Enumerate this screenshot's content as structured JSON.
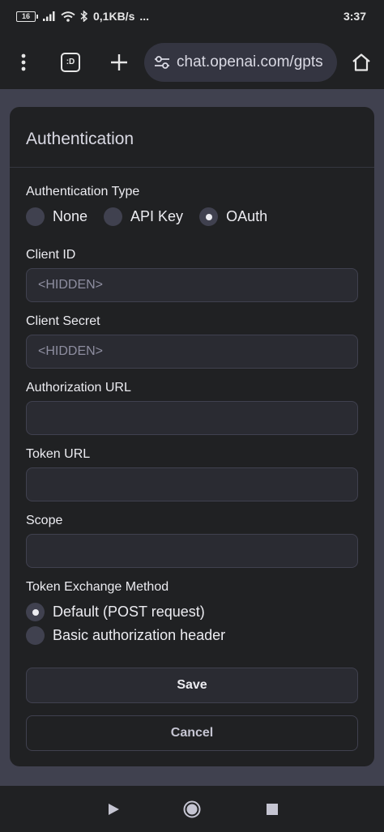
{
  "status_bar": {
    "battery": "16",
    "net_speed": "0,1KB/s",
    "more": "...",
    "time": "3:37"
  },
  "browser": {
    "tab_count": ":D",
    "url": "chat.openai.com/gpts",
    "icons": [
      "more-vert-icon",
      "tab-switcher-icon",
      "new-tab-icon",
      "site-settings-icon",
      "home-icon"
    ]
  },
  "dialog": {
    "title": "Authentication",
    "auth_type": {
      "label": "Authentication Type",
      "options": [
        {
          "label": "None",
          "checked": false
        },
        {
          "label": "API Key",
          "checked": false
        },
        {
          "label": "OAuth",
          "checked": true
        }
      ]
    },
    "client_id": {
      "label": "Client ID",
      "value": "",
      "placeholder": "<HIDDEN>"
    },
    "client_secret": {
      "label": "Client Secret",
      "value": "",
      "placeholder": "<HIDDEN>"
    },
    "authorization_url": {
      "label": "Authorization URL",
      "value": "",
      "placeholder": ""
    },
    "token_url": {
      "label": "Token URL",
      "value": "",
      "placeholder": ""
    },
    "scope": {
      "label": "Scope",
      "value": "",
      "placeholder": ""
    },
    "token_exchange": {
      "label": "Token Exchange Method",
      "options": [
        {
          "label": "Default (POST request)",
          "checked": true
        },
        {
          "label": "Basic authorization header",
          "checked": false
        }
      ]
    },
    "save_label": "Save",
    "cancel_label": "Cancel"
  },
  "nav_bar": {
    "icons": [
      "back-triangle-icon",
      "home-circle-icon",
      "recents-square-icon"
    ]
  },
  "colors": {
    "page_bg": "#40414f",
    "dialog_bg": "#202123",
    "input_bg": "#2a2b32",
    "text": "#ececf1"
  }
}
